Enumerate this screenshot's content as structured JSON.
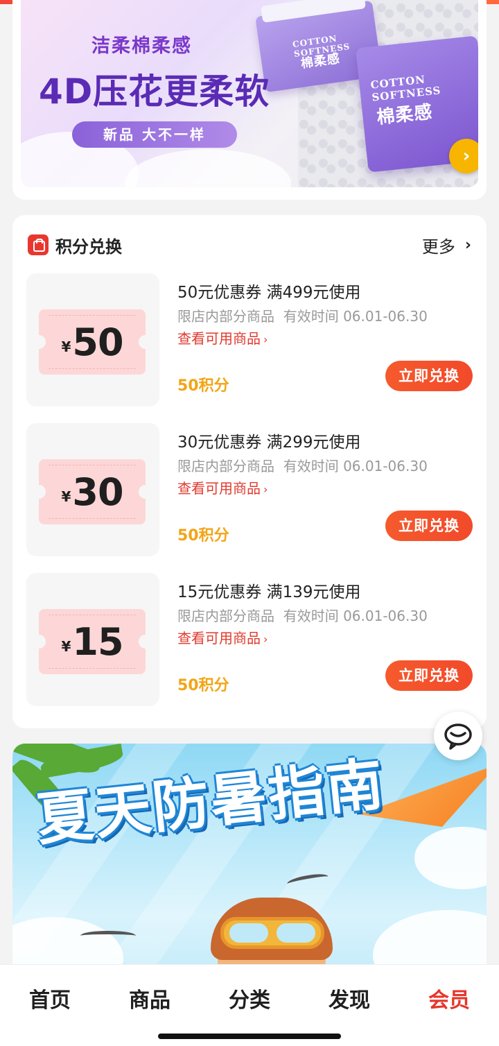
{
  "banner": {
    "tagline": "洁柔棉柔感",
    "headline": "4D压花更柔软",
    "pill": "新品 大不一样",
    "pack_label_en": "COTTON SOFTNESS",
    "pack_label_cn": "棉柔感",
    "arrow_glyph": "›"
  },
  "points_section": {
    "title": "积分兑换",
    "more_label": "更多",
    "more_glyph": "›",
    "coupons": [
      {
        "currency": "¥",
        "amount": "50",
        "title": "50元优惠券 满499元使用",
        "restriction": "限店内部分商品",
        "validity_label": "有效时间",
        "validity": "06.01-06.30",
        "link": "查看可用商品",
        "points": "50积分",
        "button": "立即兑换"
      },
      {
        "currency": "¥",
        "amount": "30",
        "title": "30元优惠券 满299元使用",
        "restriction": "限店内部分商品",
        "validity_label": "有效时间",
        "validity": "06.01-06.30",
        "link": "查看可用商品",
        "points": "50积分",
        "button": "立即兑换"
      },
      {
        "currency": "¥",
        "amount": "15",
        "title": "15元优惠券 满139元使用",
        "restriction": "限店内部分商品",
        "validity_label": "有效时间",
        "validity": "06.01-06.30",
        "link": "查看可用商品",
        "points": "50积分",
        "button": "立即兑换"
      }
    ]
  },
  "summer_banner": {
    "title": "夏天防暑指南"
  },
  "chat": {
    "icon": "chat-bubble-icon"
  },
  "tabbar": {
    "tabs": [
      {
        "label": "首页",
        "active": false
      },
      {
        "label": "商品",
        "active": false
      },
      {
        "label": "分类",
        "active": false
      },
      {
        "label": "发现",
        "active": false
      },
      {
        "label": "会员",
        "active": true
      }
    ]
  },
  "colors": {
    "accent_red": "#e5362b",
    "points_orange": "#f2a516",
    "button_red": "#f24a2b",
    "ticket_pink": "#fdd7d7"
  }
}
